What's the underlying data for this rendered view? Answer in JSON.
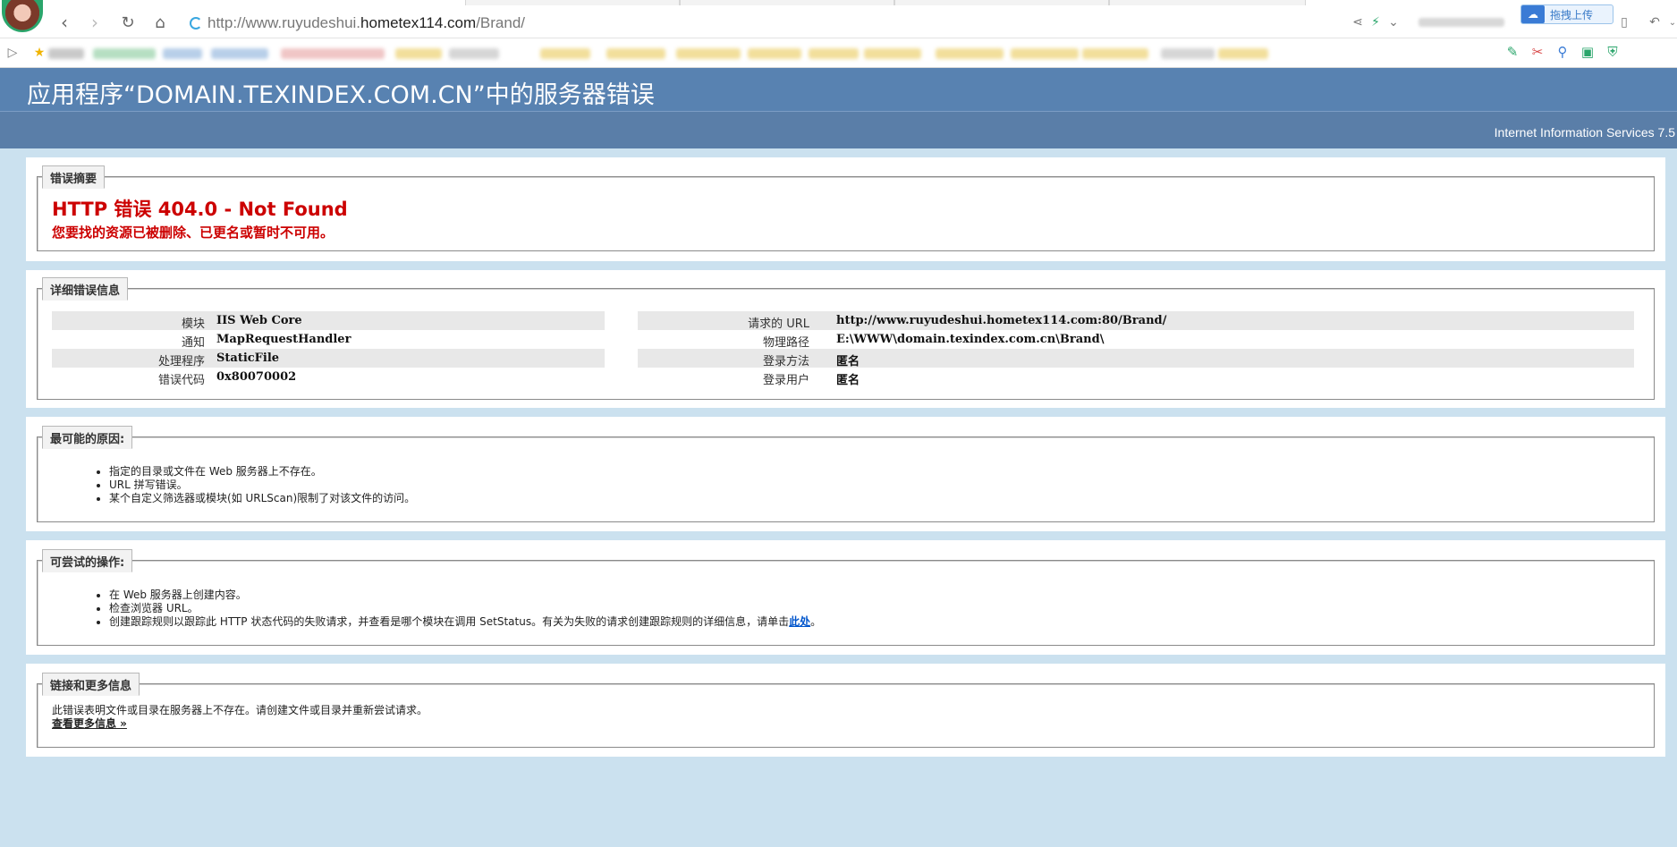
{
  "browser": {
    "address_prefix": "http://www.ruyudeshui.",
    "address_host": "hometex114.com",
    "address_suffix": "/Brand/",
    "upload_label": "拖拽上传"
  },
  "page": {
    "title": "应用程序“DOMAIN.TEXINDEX.COM.CN”中的服务器错误",
    "server_version": "Internet Information Services 7.5"
  },
  "summary": {
    "legend": "错误摘要",
    "title": "HTTP 错误 404.0 - Not Found",
    "description": "您要找的资源已被删除、已更名或暂时不可用。"
  },
  "details": {
    "legend": "详细错误信息",
    "left": [
      {
        "label": "模块",
        "value": "IIS Web Core"
      },
      {
        "label": "通知",
        "value": "MapRequestHandler"
      },
      {
        "label": "处理程序",
        "value": "StaticFile"
      },
      {
        "label": "错误代码",
        "value": "0x80070002"
      }
    ],
    "right": [
      {
        "label": "请求的 URL",
        "value": "http://www.ruyudeshui.hometex114.com:80/Brand/"
      },
      {
        "label": "物理路径",
        "value": "E:\\WWW\\domain.texindex.com.cn\\Brand\\"
      },
      {
        "label": "登录方法",
        "value": "匿名"
      },
      {
        "label": "登录用户",
        "value": "匿名"
      }
    ]
  },
  "causes": {
    "legend": "最可能的原因:",
    "items": [
      "指定的目录或文件在 Web 服务器上不存在。",
      "URL 拼写错误。",
      "某个自定义筛选器或模块(如 URLScan)限制了对该文件的访问。"
    ]
  },
  "actions": {
    "legend": "可尝试的操作:",
    "items": [
      "在 Web 服务器上创建内容。",
      "检查浏览器 URL。"
    ],
    "last_item_text": "创建跟踪规则以跟踪此 HTTP 状态代码的失败请求，并查看是哪个模块在调用 SetStatus。有关为失败的请求创建跟踪规则的详细信息，请单击",
    "last_item_link": "此处",
    "last_item_end": "。"
  },
  "links": {
    "legend": "链接和更多信息",
    "text": "此错误表明文件或目录在服务器上不存在。请创建文件或目录并重新尝试请求。",
    "more_link": "查看更多信息 »"
  }
}
